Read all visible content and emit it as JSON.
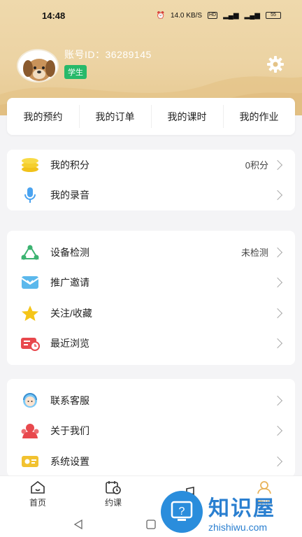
{
  "status_bar": {
    "time": "14:48",
    "net_speed": "14.0 KB/S",
    "battery": "55"
  },
  "profile": {
    "account_label": "账号ID：",
    "account_id": "36289145",
    "role_badge": "学生"
  },
  "quick_tabs": [
    "我的预约",
    "我的订单",
    "我的课时",
    "我的作业"
  ],
  "card1": [
    {
      "label": "我的积分",
      "value": "0积分",
      "icon": "coins-icon"
    },
    {
      "label": "我的录音",
      "value": "",
      "icon": "microphone-icon"
    }
  ],
  "card2": [
    {
      "label": "设备检测",
      "value": "未检测",
      "icon": "device-check-icon"
    },
    {
      "label": "推广邀请",
      "value": "",
      "icon": "invite-envelope-icon"
    },
    {
      "label": "关注/收藏",
      "value": "",
      "icon": "star-icon"
    },
    {
      "label": "最近浏览",
      "value": "",
      "icon": "history-icon"
    }
  ],
  "card3": [
    {
      "label": "联系客服",
      "value": "",
      "icon": "customer-service-icon"
    },
    {
      "label": "关于我们",
      "value": "",
      "icon": "about-us-icon"
    },
    {
      "label": "系统设置",
      "value": "",
      "icon": "settings-panel-icon"
    }
  ],
  "bottom_nav": [
    "首页",
    "约课",
    "",
    "我的"
  ],
  "watermark": {
    "cn": "知识屋",
    "en": "zhishiwu.com"
  },
  "colors": {
    "header": "#ecd3a3",
    "badge": "#27b96a",
    "accent": "#e8b35a"
  }
}
